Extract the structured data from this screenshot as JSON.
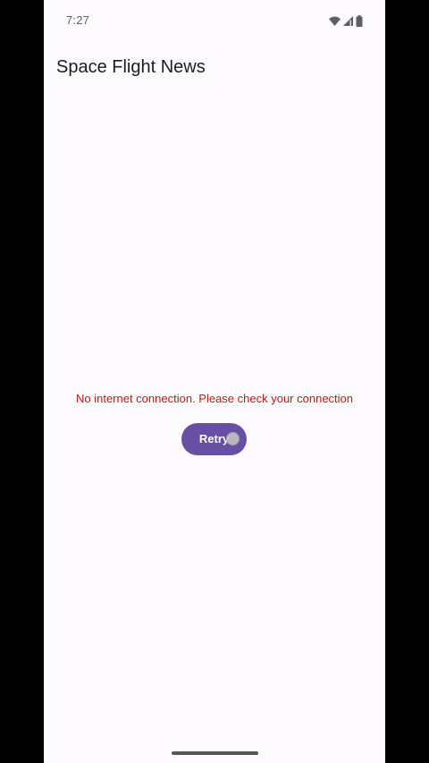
{
  "status_bar": {
    "time": "7:27",
    "icons": [
      "wifi-icon",
      "signal-icon",
      "battery-icon"
    ]
  },
  "app_bar": {
    "title": "Space Flight News"
  },
  "main": {
    "error_message": "No internet connection. Please check your connection",
    "retry_label": "Retry"
  },
  "colors": {
    "background": "#fdfbfe",
    "error_text": "#ba1a1a",
    "primary": "#6750a4",
    "on_primary": "#ffffff",
    "title_text": "#1c1b1f"
  }
}
